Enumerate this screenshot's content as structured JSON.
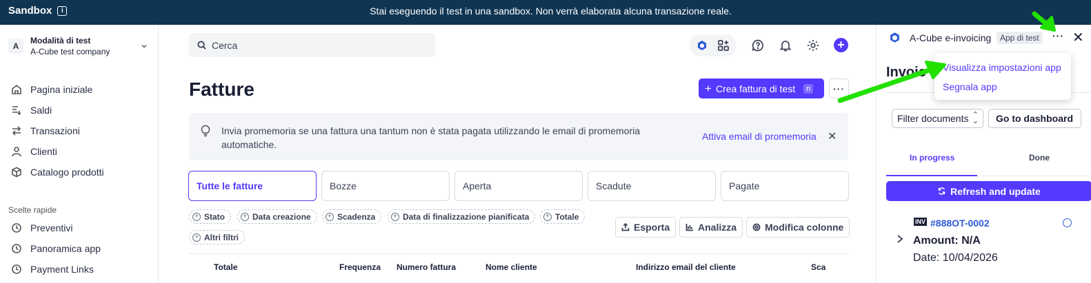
{
  "banner": {
    "brand": "Sandbox",
    "info_icon": "i",
    "message": "Stai eseguendo il test in una sandbox. Non verrà elaborata alcuna transazione reale."
  },
  "account": {
    "avatar": "A",
    "mode": "Modalità di test",
    "company": "A-Cube test company"
  },
  "nav": {
    "items": [
      {
        "label": "Pagina iniziale",
        "icon": "home-icon"
      },
      {
        "label": "Saldi",
        "icon": "balance-icon"
      },
      {
        "label": "Transazioni",
        "icon": "transfer-icon"
      },
      {
        "label": "Clienti",
        "icon": "person-icon"
      },
      {
        "label": "Catalogo prodotti",
        "icon": "box-icon"
      }
    ],
    "shortcuts_label": "Scelte rapide",
    "shortcuts": [
      {
        "label": "Preventivi",
        "icon": "clock-icon"
      },
      {
        "label": "Panoramica app",
        "icon": "clock-icon"
      },
      {
        "label": "Payment Links",
        "icon": "clock-icon"
      }
    ]
  },
  "header": {
    "search_placeholder": "Cerca",
    "plus": "+"
  },
  "main": {
    "title": "Fatture",
    "create_button": "Crea fattura di test",
    "create_shortcut": "n",
    "more": "···",
    "tip": {
      "text": "Invia promemoria se una fattura una tantum non è stata pagata utilizzando le email di promemoria automatiche.",
      "link": "Attiva email di promemoria",
      "close": "✕"
    },
    "tabs": [
      "Tutte le fatture",
      "Bozze",
      "Aperta",
      "Scadute",
      "Pagate"
    ],
    "filters": [
      "Stato",
      "Data creazione",
      "Scadenza",
      "Data di finalizzazione pianificata",
      "Totale",
      "Altri filtri"
    ],
    "actions": [
      "Esporta",
      "Analizza",
      "Modifica colonne"
    ],
    "columns": [
      "Totale",
      "Frequenza",
      "Numero fattura",
      "Nome cliente",
      "Indirizzo email del cliente",
      "Sca"
    ]
  },
  "panel": {
    "app_name": "A-Cube e-invoicing",
    "badge": "App di test",
    "dots": "···",
    "close": "✕",
    "heading": "Invoic",
    "filter": "Filter documents",
    "dashboard": "Go to dashboard",
    "tabs": [
      "In progress",
      "Done"
    ],
    "refresh": "Refresh and update",
    "invoice": {
      "badge": "INV",
      "number": "#888OT-0002",
      "amount": "Amount: N/A",
      "date": "Date: 10/04/2026"
    }
  },
  "menu": {
    "items": [
      "Visualizza impostazioni app",
      "Segnala app"
    ]
  },
  "colors": {
    "accent": "#533afd",
    "banner": "#0f3553",
    "annotation_arrow": "#22e000"
  }
}
